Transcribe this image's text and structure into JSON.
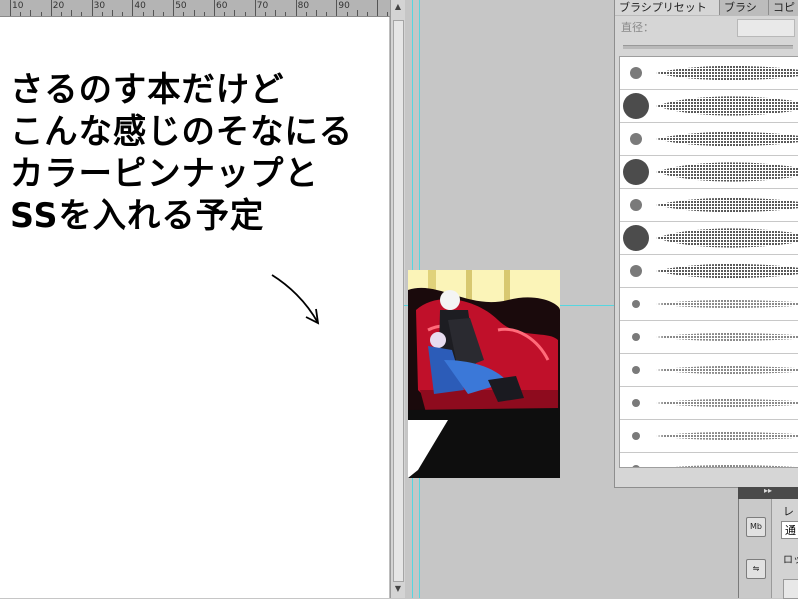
{
  "ruler": {
    "labels": [
      "10",
      "20",
      "30",
      "40",
      "50",
      "60",
      "70",
      "80",
      "90"
    ]
  },
  "canvas_note": {
    "lines": [
      "さるのす本だけど",
      "こんな感じのそなにる",
      "カラーピンナップと",
      "SSを入れる予定"
    ]
  },
  "brush_panel": {
    "tabs": [
      "ブラシプリセット",
      "ブラシ",
      "コピ"
    ],
    "diameter_label": "直径："
  },
  "layers_panel": {
    "tab_label": "レ",
    "blend_mode": "通",
    "lock_label": "ロッ",
    "mini_icon_label": "Mb"
  },
  "colors": {
    "guide": "#56d6e0",
    "sofa_red": "#c0102a",
    "dress_blue": "#2c5cb8"
  }
}
